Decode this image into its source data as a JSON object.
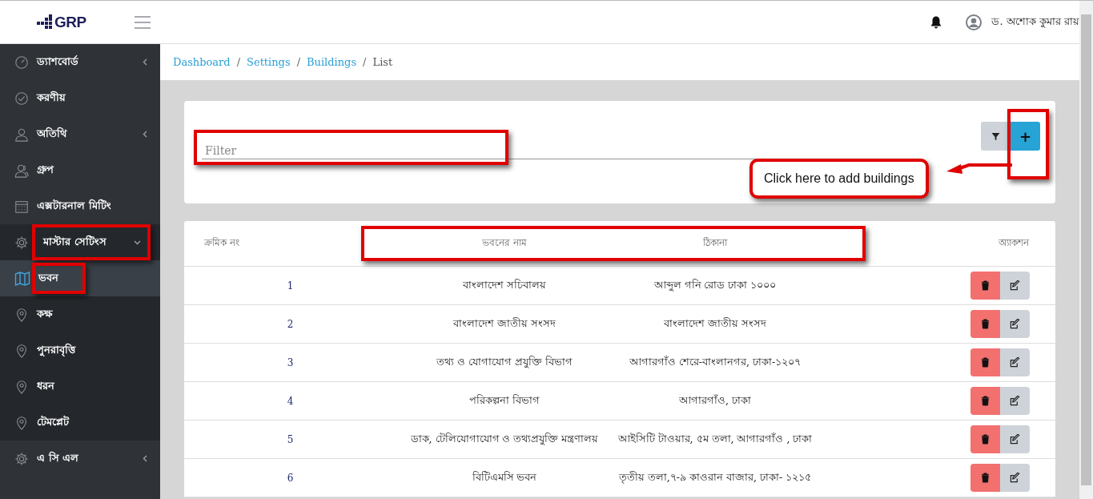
{
  "header": {
    "logo": "GRP",
    "user_name": "ড. অশোক কুমার রায়"
  },
  "sidebar": {
    "items": [
      {
        "label": "ড্যাশবোর্ড",
        "kind": "group",
        "expanded": false,
        "selected": false,
        "highlighted": false
      },
      {
        "label": "করণীয়",
        "kind": "link",
        "selected": false,
        "highlighted": false
      },
      {
        "label": "অতিথি",
        "kind": "group",
        "expanded": false,
        "selected": false,
        "highlighted": false
      },
      {
        "label": "গ্রুপ",
        "kind": "link",
        "selected": false,
        "highlighted": false
      },
      {
        "label": "এক্সটারনাল মিটিং",
        "kind": "link",
        "selected": false,
        "highlighted": false
      },
      {
        "label": "মাস্টার সেটিংস",
        "kind": "group",
        "expanded": true,
        "selected": false,
        "highlighted": true,
        "children": [
          {
            "label": "ভবন",
            "selected": true,
            "highlighted": true
          },
          {
            "label": "কক্ষ",
            "selected": false,
            "highlighted": false
          },
          {
            "label": "পুনরাবৃত্তি",
            "selected": false,
            "highlighted": false
          },
          {
            "label": "ধরন",
            "selected": false,
            "highlighted": false
          },
          {
            "label": "টেমপ্লেট",
            "selected": false,
            "highlighted": false
          }
        ]
      },
      {
        "label": "এ সি এল",
        "kind": "group",
        "expanded": false,
        "selected": false,
        "highlighted": false
      }
    ]
  },
  "breadcrumb": [
    {
      "label": "Dashboard",
      "kind": "link"
    },
    {
      "label": "/",
      "kind": "separator"
    },
    {
      "label": "Settings",
      "kind": "link"
    },
    {
      "label": "/",
      "kind": "separator"
    },
    {
      "label": "Buildings",
      "kind": "link"
    },
    {
      "label": "/",
      "kind": "separator"
    },
    {
      "label": "List",
      "kind": "current"
    }
  ],
  "filter": {
    "placeholder": "Filter",
    "highlighted": true
  },
  "add_button": {
    "label": "+",
    "highlighted": true
  },
  "callout": "Click here to add buildings",
  "table": {
    "header_highlighted": true,
    "columns": [
      {
        "label": "ক্রমিক নং"
      },
      {
        "label": "ভবনের নাম"
      },
      {
        "label": "ঠিকানা"
      },
      {
        "label": "অ্যাকশন"
      }
    ],
    "rows": [
      {
        "serial": "1",
        "name": "বাংলাদেশ সচিবালয়",
        "address": "আব্দুল গনি রোড ঢাকা ১০০০"
      },
      {
        "serial": "2",
        "name": "বাংলাদেশ জাতীয় সংসদ",
        "address": "বাংলাদেশ জাতীয় সংসদ"
      },
      {
        "serial": "3",
        "name": "তথ্য ও যোগাযোগ প্রযুক্তি বিভাগ",
        "address": "আগারগাঁও শেরে-বাংলানগর, ঢাকা-১২০৭"
      },
      {
        "serial": "4",
        "name": "পরিকল্পনা বিভাগ",
        "address": "আগারগাঁও, ঢাকা"
      },
      {
        "serial": "5",
        "name": "ডাক, টেলিযোগাযোগ ও তথ্যপ্রযুক্তি মন্ত্রণালয়",
        "address": "আইসিটি টাওয়ার, ৫ম তলা, আগারগাঁও , ঢাকা"
      },
      {
        "serial": "6",
        "name": "বিটিএমসি ভবন",
        "address": "তৃতীয় তলা,৭-৯ কাওরান বাজার, ঢাকা- ১২১৫"
      }
    ]
  }
}
